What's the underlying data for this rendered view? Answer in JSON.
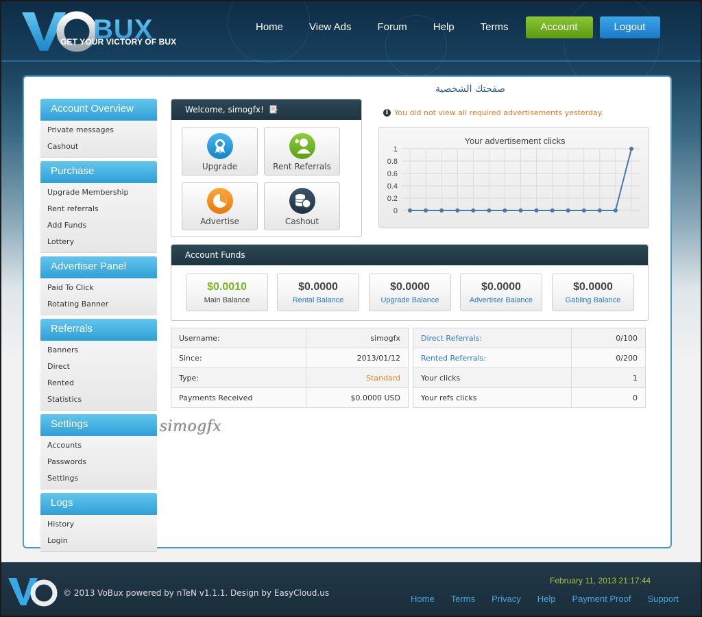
{
  "header": {
    "logo_tagline": "GET YOUR VICTORY OF BUX",
    "nav": [
      "Home",
      "View Ads",
      "Forum",
      "Help",
      "Terms"
    ],
    "account_label": "Account",
    "logout_label": "Logout"
  },
  "sidebar": {
    "sections": [
      {
        "title": "Account Overview",
        "items": [
          "Private messages",
          "Cashout"
        ]
      },
      {
        "title": "Purchase",
        "items": [
          "Upgrade Membership",
          "Rent referrals",
          "Add Funds",
          "Lottery"
        ]
      },
      {
        "title": "Advertiser Panel",
        "items": [
          "Paid To Click",
          "Rotating Banner"
        ]
      },
      {
        "title": "Referrals",
        "items": [
          "Banners",
          "Direct",
          "Rented",
          "Statistics"
        ]
      },
      {
        "title": "Settings",
        "items": [
          "Accounts",
          "Passwords",
          "Settings"
        ]
      },
      {
        "title": "Logs",
        "items": [
          "History",
          "Login"
        ]
      }
    ]
  },
  "welcome": {
    "title": "Welcome, simogfx!",
    "tiles": [
      {
        "label": "Upgrade",
        "icon": "upgrade-badge-icon"
      },
      {
        "label": "Rent Referrals",
        "icon": "add-user-icon"
      },
      {
        "label": "Advertise",
        "icon": "pie-chart-icon"
      },
      {
        "label": "Cashout",
        "icon": "coins-icon"
      }
    ]
  },
  "arabic_title": "صفحتك الشخصية",
  "notice": "You did not view all required advertisements yesterday.",
  "chart_data": {
    "type": "line",
    "title": "Your advertisement clicks",
    "x": [
      1,
      2,
      3,
      4,
      5,
      6,
      7,
      8,
      9,
      10,
      11,
      12,
      13,
      14,
      15
    ],
    "values": [
      0,
      0,
      0,
      0,
      0,
      0,
      0,
      0,
      0,
      0,
      0,
      0,
      0,
      0,
      1
    ],
    "ylim": [
      0,
      1
    ],
    "yticks": [
      "0",
      "0.2",
      "0.4",
      "0.6",
      "0.8",
      "1"
    ],
    "grid": true,
    "color": "#4a78a8"
  },
  "funds": {
    "title": "Account Funds",
    "items": [
      {
        "amount": "$0.0010",
        "label": "Main Balance",
        "highlight": true
      },
      {
        "amount": "$0.0000",
        "label": "Rental Balance"
      },
      {
        "amount": "$0.0000",
        "label": "Upgrade Balance"
      },
      {
        "amount": "$0.0000",
        "label": "Advertiser Balance"
      },
      {
        "amount": "$0.0000",
        "label": "Gabling Balance"
      }
    ]
  },
  "stats_left": [
    {
      "key": "Username:",
      "value": "simogfx"
    },
    {
      "key": "Since:",
      "value": "2013/01/12"
    },
    {
      "key": "Type:",
      "value": "Standard"
    },
    {
      "key": "Payments Received",
      "value": "$0.0000 USD"
    }
  ],
  "stats_right": [
    {
      "key": "Direct Referrals:",
      "value": "0/100"
    },
    {
      "key": "Rented Referrals:",
      "value": "0/200"
    },
    {
      "key": "Your clicks",
      "value": "1"
    },
    {
      "key": "Your refs clicks",
      "value": "0"
    }
  ],
  "signature": "simogfx",
  "footer": {
    "copyright": "© 2013 VoBux powered by nTeN v1.1.1. Design by EasyCloud.us",
    "datetime": "February 11, 2013 21:17:44",
    "links": [
      "Home",
      "Terms",
      "Privacy",
      "Help",
      "Payment Proof",
      "Support"
    ]
  },
  "colors": {
    "accent_blue": "#2f9fd6",
    "account_green": "#6aaa1a",
    "link_blue": "#2a7ac2",
    "warning_orange": "#e8772a",
    "balance_green": "#7ab51d"
  }
}
